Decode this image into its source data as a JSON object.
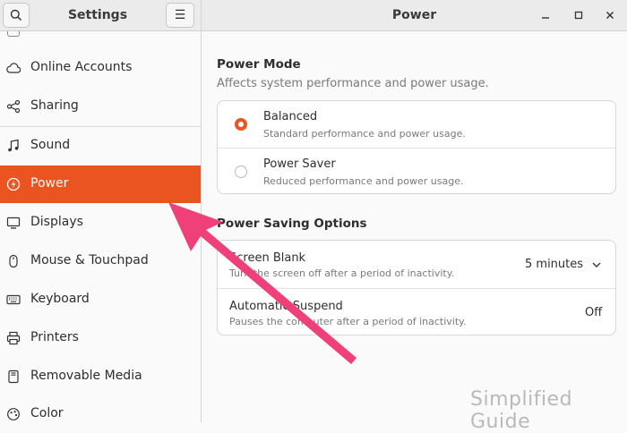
{
  "sidebar": {
    "title": "Settings",
    "search_icon": "search-icon",
    "menu_icon": "hamburger-menu-icon",
    "items": [
      {
        "label": "Online Accounts",
        "icon": "cloud-icon"
      },
      {
        "label": "Sharing",
        "icon": "share-icon"
      },
      {
        "label": "Sound",
        "icon": "music-note-icon"
      },
      {
        "label": "Power",
        "icon": "power-bolt-icon",
        "active": true
      },
      {
        "label": "Displays",
        "icon": "display-icon"
      },
      {
        "label": "Mouse & Touchpad",
        "icon": "mouse-icon"
      },
      {
        "label": "Keyboard",
        "icon": "keyboard-icon"
      },
      {
        "label": "Printers",
        "icon": "printer-icon"
      },
      {
        "label": "Removable Media",
        "icon": "removable-media-icon"
      },
      {
        "label": "Color",
        "icon": "color-icon"
      }
    ]
  },
  "window": {
    "title": "Power",
    "minimize_icon": "minimize-icon",
    "maximize_icon": "maximize-icon",
    "close_icon": "close-icon"
  },
  "power_mode": {
    "title": "Power Mode",
    "subtitle": "Affects system performance and power usage.",
    "options": [
      {
        "label": "Balanced",
        "description": "Standard performance and power usage.",
        "selected": true
      },
      {
        "label": "Power Saver",
        "description": "Reduced performance and power usage.",
        "selected": false
      }
    ]
  },
  "power_saving": {
    "title": "Power Saving Options",
    "rows": [
      {
        "label": "Screen Blank",
        "description": "Turn the screen off after a period of inactivity.",
        "value": "5 minutes"
      },
      {
        "label": "Automatic Suspend",
        "description": "Pauses the computer after a period of inactivity.",
        "value": "Off"
      }
    ]
  },
  "watermark": "Simplified Guide",
  "colors": {
    "accent": "#e95420",
    "annotation_arrow": "#f0407a"
  }
}
